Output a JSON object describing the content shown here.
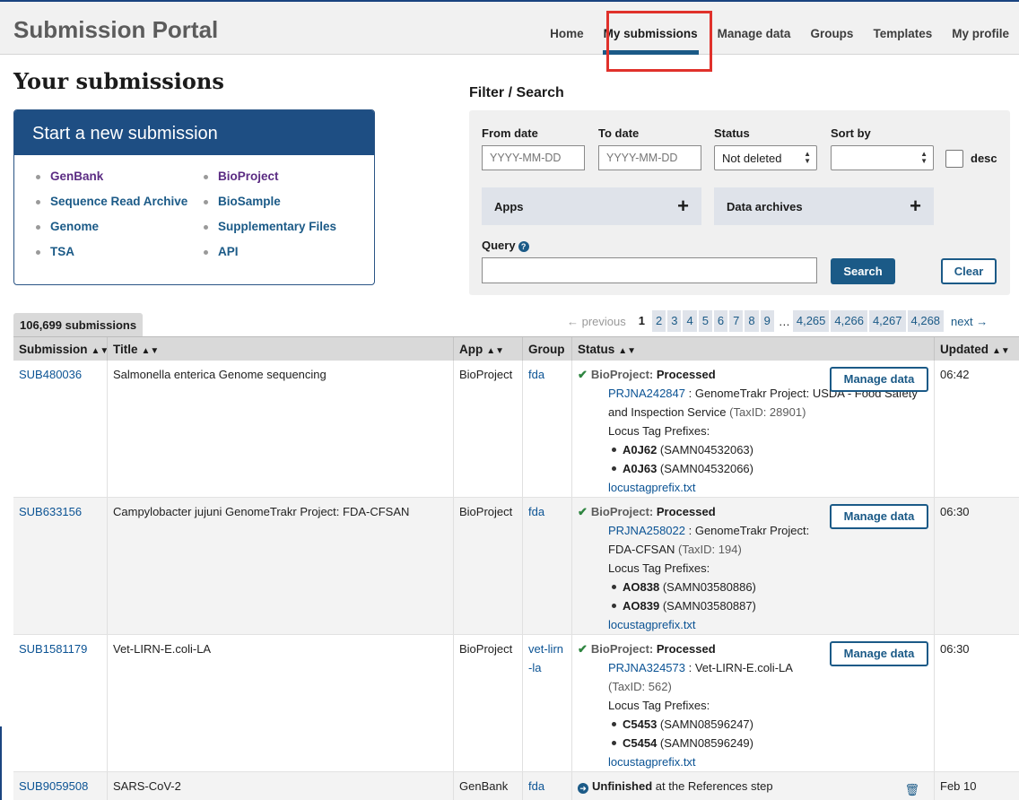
{
  "header": {
    "brand": "Submission Portal",
    "nav": [
      "Home",
      "My submissions",
      "Manage data",
      "Groups",
      "Templates",
      "My profile"
    ],
    "active_nav": "My submissions",
    "highlight_color": "#e0312b",
    "brand_color": "#1e4e83"
  },
  "page": {
    "title": "Your submissions"
  },
  "new_submission": {
    "heading": "Start a new submission",
    "col1": [
      "GenBank",
      "Sequence Read Archive",
      "Genome",
      "TSA"
    ],
    "col2": [
      "BioProject",
      "BioSample",
      "Supplementary Files",
      "API"
    ]
  },
  "filter": {
    "title": "Filter / Search",
    "from_label": "From date",
    "from_placeholder": "YYYY-MM-DD",
    "to_label": "To date",
    "to_placeholder": "YYYY-MM-DD",
    "status_label": "Status",
    "status_value": "Not deleted",
    "sort_label": "Sort by",
    "sort_value": "",
    "desc_label": "desc",
    "apps_label": "Apps",
    "archives_label": "Data archives",
    "query_label": "Query",
    "search_btn": "Search",
    "clear_btn": "Clear"
  },
  "list": {
    "count": "106,699 submissions",
    "pager": {
      "prev": "← previous",
      "current": "1",
      "pages": [
        "2",
        "3",
        "4",
        "5",
        "6",
        "7",
        "8",
        "9"
      ],
      "dots": "…",
      "tail": [
        "4,265",
        "4,266",
        "4,267",
        "4,268"
      ],
      "next": "next →"
    },
    "columns": [
      "Submission",
      "Title",
      "App",
      "Group",
      "Status",
      "Updated"
    ],
    "rows": [
      {
        "id": "SUB480036",
        "title": "Salmonella enterica Genome sequencing",
        "app": "BioProject",
        "group": "fda",
        "status_label": "BioProject:",
        "status_value": "Processed",
        "accession": "PRJNA242847",
        "desc": " : GenomeTrakr Project: USDA - Food Safety and Inspection Service",
        "taxid": " (TaxID: 28901)",
        "prefix_label": "Locus Tag Prefixes:",
        "prefixes": [
          {
            "tag": "A0J62",
            "sample": " (SAMN04532063)"
          },
          {
            "tag": "A0J63",
            "sample": " (SAMN04532066)"
          }
        ],
        "file": "locustagprefix.txt",
        "action": "Manage data",
        "updated": "06:42"
      },
      {
        "id": "SUB633156",
        "title": "Campylobacter jujuni GenomeTrakr Project: FDA-CFSAN",
        "app": "BioProject",
        "group": "fda",
        "status_label": "BioProject:",
        "status_value": "Processed",
        "accession": "PRJNA258022",
        "desc": " : GenomeTrakr Project: FDA-CFSAN",
        "taxid": " (TaxID: 194)",
        "prefix_label": "Locus Tag Prefixes:",
        "prefixes": [
          {
            "tag": "AO838",
            "sample": " (SAMN03580886)"
          },
          {
            "tag": "AO839",
            "sample": " (SAMN03580887)"
          }
        ],
        "file": "locustagprefix.txt",
        "action": "Manage data",
        "updated": "06:30"
      },
      {
        "id": "SUB1581179",
        "title": "Vet-LIRN-E.coli-LA",
        "app": "BioProject",
        "group": "vet-lirn-la",
        "status_label": "BioProject:",
        "status_value": "Processed",
        "accession": "PRJNA324573",
        "desc": " : Vet-LIRN-E.coli-LA",
        "taxid": " (TaxID: 562)",
        "prefix_label": "Locus Tag Prefixes:",
        "prefixes": [
          {
            "tag": "C5453",
            "sample": " (SAMN08596247)"
          },
          {
            "tag": "C5454",
            "sample": " (SAMN08596249)"
          }
        ],
        "file": "locustagprefix.txt",
        "action": "Manage data",
        "updated": "06:30"
      },
      {
        "id": "SUB9059508",
        "title": "SARS-CoV-2",
        "app": "GenBank",
        "group": "fda",
        "status_value": "Unfinished",
        "status_rest": " at the References step",
        "updated": "Feb 10"
      }
    ]
  }
}
